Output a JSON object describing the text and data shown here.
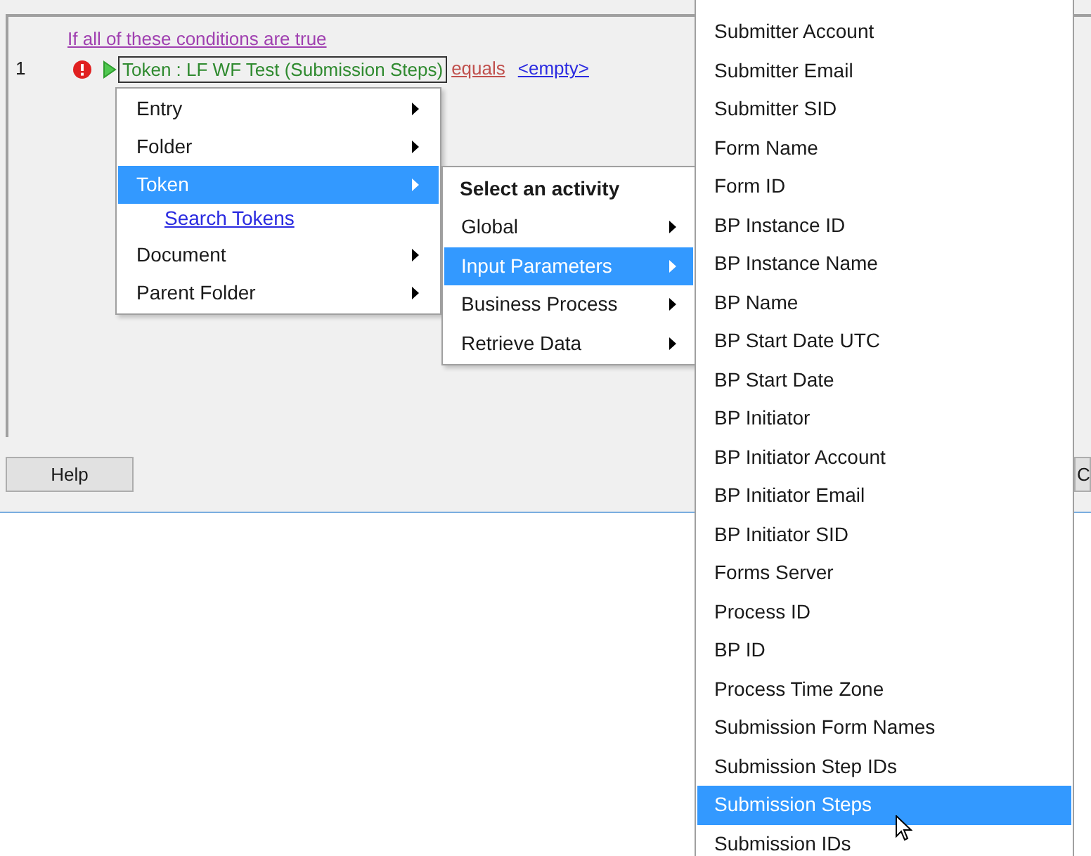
{
  "conditions": {
    "heading": "If all of these conditions are true",
    "rows": [
      {
        "number": "1",
        "error": true,
        "token": "Token : LF WF Test (Submission Steps)",
        "operator": "equals",
        "value": "<empty>"
      }
    ]
  },
  "menu_1": [
    {
      "kind": "item",
      "label": "Entry",
      "submenu": true,
      "selected": false
    },
    {
      "kind": "item",
      "label": "Folder",
      "submenu": true,
      "selected": false
    },
    {
      "kind": "item",
      "label": "Token",
      "submenu": true,
      "selected": true
    },
    {
      "kind": "link",
      "label": "Search Tokens"
    },
    {
      "kind": "item",
      "label": "Document",
      "submenu": true,
      "selected": false
    },
    {
      "kind": "item",
      "label": "Parent Folder",
      "submenu": true,
      "selected": false
    }
  ],
  "menu_2": [
    {
      "kind": "header",
      "label": "Select an activity"
    },
    {
      "kind": "item",
      "label": "Global",
      "submenu": true,
      "selected": false
    },
    {
      "kind": "item",
      "label": "Input Parameters",
      "submenu": true,
      "selected": true
    },
    {
      "kind": "item",
      "label": "Business Process",
      "submenu": true,
      "selected": false
    },
    {
      "kind": "item",
      "label": "Retrieve Data",
      "submenu": true,
      "selected": false
    }
  ],
  "menu_3": [
    {
      "label": "Submitter Account",
      "selected": false
    },
    {
      "label": "Submitter Email",
      "selected": false
    },
    {
      "label": "Submitter SID",
      "selected": false
    },
    {
      "label": "Form Name",
      "selected": false
    },
    {
      "label": "Form ID",
      "selected": false
    },
    {
      "label": "BP Instance ID",
      "selected": false
    },
    {
      "label": "BP Instance Name",
      "selected": false
    },
    {
      "label": "BP Name",
      "selected": false
    },
    {
      "label": "BP Start Date UTC",
      "selected": false
    },
    {
      "label": "BP Start Date",
      "selected": false
    },
    {
      "label": "BP Initiator",
      "selected": false
    },
    {
      "label": "BP Initiator Account",
      "selected": false
    },
    {
      "label": "BP Initiator Email",
      "selected": false
    },
    {
      "label": "BP Initiator SID",
      "selected": false
    },
    {
      "label": "Forms Server",
      "selected": false
    },
    {
      "label": "Process ID",
      "selected": false
    },
    {
      "label": "BP ID",
      "selected": false
    },
    {
      "label": "Process Time Zone",
      "selected": false
    },
    {
      "label": "Submission Form Names",
      "selected": false
    },
    {
      "label": "Submission Step IDs",
      "selected": false
    },
    {
      "label": "Submission Steps",
      "selected": true
    },
    {
      "label": "Submission IDs",
      "selected": false
    }
  ],
  "buttons": [
    {
      "label": "Help"
    },
    {
      "label": "C"
    }
  ]
}
